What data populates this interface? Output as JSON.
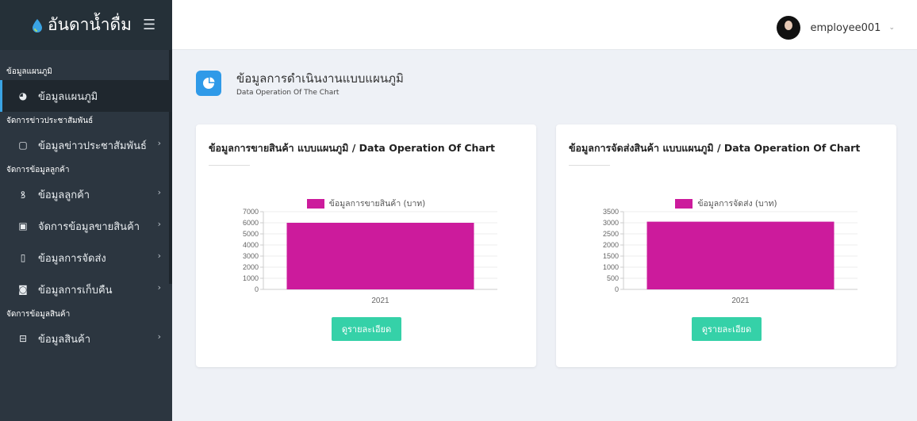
{
  "brand": {
    "title": "อันดาน้ำดื่ม"
  },
  "sidebar": {
    "sections": [
      {
        "label": "ข้อมูลแผนภูมิ"
      },
      {
        "label": "จัดการข่าวประชาสัมพันธ์"
      },
      {
        "label": "จัดการข้อมูลลูกค้า"
      },
      {
        "label": "จัดการข้อมูลสินค้า"
      }
    ],
    "items": [
      {
        "label": "ข้อมูลแผนภูมิ",
        "icon": "pie-chart-icon"
      },
      {
        "label": "ข้อมูลข่าวประชาสัมพันธ์",
        "icon": "news-icon"
      },
      {
        "label": "ข้อมูลลูกค้า",
        "icon": "users-icon"
      },
      {
        "label": "จัดการข้อมูลขายสินค้า",
        "icon": "basket-icon"
      },
      {
        "label": "ข้อมูลการจัดส่ง",
        "icon": "box-icon"
      },
      {
        "label": "ข้อมูลการเก็บคืน",
        "icon": "truck-icon"
      },
      {
        "label": "ข้อมูลสินค้า",
        "icon": "cart-icon"
      }
    ]
  },
  "user": {
    "name": "employee001"
  },
  "page": {
    "title": "ข้อมูลการดำเนินงานแบบแผนภูมิ",
    "subtitle": "Data Operation Of The Chart"
  },
  "cards": [
    {
      "title": "ข้อมูลการขายสินค้า แบบแผนภูมิ / Data Operation Of Chart",
      "button": "ดูรายละเอียด"
    },
    {
      "title": "ข้อมูลการจัดส่งสินค้า แบบแผนภูมิ / Data Operation Of Chart",
      "button": "ดูรายละเอียด"
    }
  ],
  "colors": {
    "bar": "#cc1b9c",
    "button": "#35d1a8",
    "accent": "#2f9ae8"
  },
  "chart_data": [
    {
      "type": "bar",
      "categories": [
        "2021"
      ],
      "series": [
        {
          "name": "ข้อมูลการขายสินค้า (บาท)",
          "values": [
            6000
          ]
        }
      ],
      "yticks": [
        0,
        1000,
        2000,
        3000,
        4000,
        5000,
        6000,
        7000
      ],
      "ylim": [
        0,
        7000
      ],
      "grid": true,
      "legend": "top"
    },
    {
      "type": "bar",
      "categories": [
        "2021"
      ],
      "series": [
        {
          "name": "ข้อมูลการจัดส่ง (บาท)",
          "values": [
            3050
          ]
        }
      ],
      "yticks": [
        0,
        500,
        1000,
        1500,
        2000,
        2500,
        3000,
        3500
      ],
      "ylim": [
        0,
        3500
      ],
      "grid": true,
      "legend": "top"
    }
  ]
}
